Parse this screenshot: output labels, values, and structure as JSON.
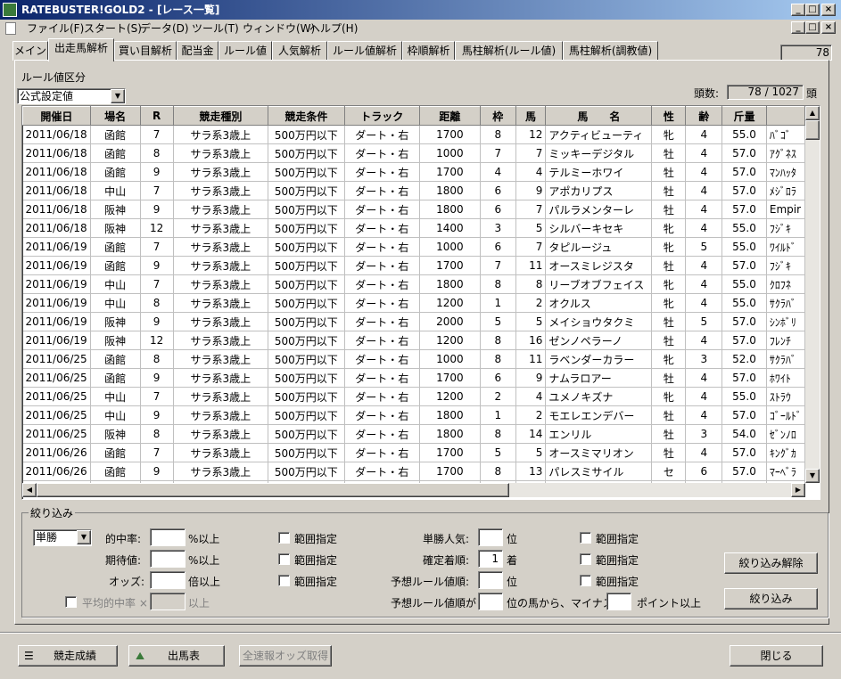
{
  "window": {
    "title": "RATEBUSTER!GOLD2 - [レース一覧]",
    "min": "_",
    "max": "□",
    "close": "×"
  },
  "menu": [
    "ファイル(F)",
    "スタート(S)",
    "データ(D)",
    "ツール(T)",
    "ウィンドウ(W)",
    "ヘルプ(H)"
  ],
  "tabs": [
    "メイン",
    "出走馬解析",
    "買い目解析",
    "配当金",
    "ルール値",
    "人気解析",
    "ルール値解析",
    "枠順解析",
    "馬柱解析(ルール値)",
    "馬柱解析(調教値)"
  ],
  "active_tab": "出走馬解析",
  "top_counter": "78",
  "rule_section": {
    "label": "ルール値区分",
    "selected": "公式設定値"
  },
  "count": {
    "label": "頭数:",
    "value": "78 / 1027",
    "unit": "頭"
  },
  "table": {
    "columns": [
      "開催日",
      "場名",
      "R",
      "競走種別",
      "競走条件",
      "トラック",
      "距離",
      "枠",
      "馬",
      "馬　　名",
      "性",
      "齢",
      "斤量",
      ""
    ],
    "rows": [
      [
        "2011/06/18",
        "函館",
        "7",
        "サラ系3歳上",
        "500万円以下",
        "ダート・右",
        "1700",
        "8",
        "12",
        "アクティビューティ",
        "牝",
        "4",
        "55.0",
        "ﾊﾞｺﾞ"
      ],
      [
        "2011/06/18",
        "函館",
        "8",
        "サラ系3歳上",
        "500万円以下",
        "ダート・右",
        "1000",
        "7",
        "7",
        "ミッキーデジタル",
        "牡",
        "4",
        "57.0",
        "ｱｸﾞﾈｽ"
      ],
      [
        "2011/06/18",
        "函館",
        "9",
        "サラ系3歳上",
        "500万円以下",
        "ダート・右",
        "1700",
        "4",
        "4",
        "テルミーホワイ",
        "牡",
        "4",
        "57.0",
        "ﾏﾝﾊｯﾀ"
      ],
      [
        "2011/06/18",
        "中山",
        "7",
        "サラ系3歳上",
        "500万円以下",
        "ダート・右",
        "1800",
        "6",
        "9",
        "アポカリプス",
        "牡",
        "4",
        "57.0",
        "ﾒｼﾞﾛﾗ"
      ],
      [
        "2011/06/18",
        "阪神",
        "9",
        "サラ系3歳上",
        "500万円以下",
        "ダート・右",
        "1800",
        "6",
        "7",
        "パルラメンターレ",
        "牡",
        "4",
        "57.0",
        "Empir"
      ],
      [
        "2011/06/18",
        "阪神",
        "12",
        "サラ系3歳上",
        "500万円以下",
        "ダート・右",
        "1400",
        "3",
        "5",
        "シルバーキセキ",
        "牝",
        "4",
        "55.0",
        "ﾌｼﾞｷ"
      ],
      [
        "2011/06/19",
        "函館",
        "7",
        "サラ系3歳上",
        "500万円以下",
        "ダート・右",
        "1000",
        "6",
        "7",
        "タピルージュ",
        "牝",
        "5",
        "55.0",
        "ﾜｲﾙﾄﾞ"
      ],
      [
        "2011/06/19",
        "函館",
        "9",
        "サラ系3歳上",
        "500万円以下",
        "ダート・右",
        "1700",
        "7",
        "11",
        "オースミレジスタ",
        "牡",
        "4",
        "57.0",
        "ﾌｼﾞｷ"
      ],
      [
        "2011/06/19",
        "中山",
        "7",
        "サラ系3歳上",
        "500万円以下",
        "ダート・右",
        "1800",
        "8",
        "8",
        "リーブオブフェイス",
        "牝",
        "4",
        "55.0",
        "ｸﾛﾌﾈ"
      ],
      [
        "2011/06/19",
        "中山",
        "8",
        "サラ系3歳上",
        "500万円以下",
        "ダート・右",
        "1200",
        "1",
        "2",
        "オクルス",
        "牝",
        "4",
        "55.0",
        "ｻｸﾗﾊﾞ"
      ],
      [
        "2011/06/19",
        "阪神",
        "9",
        "サラ系3歳上",
        "500万円以下",
        "ダート・右",
        "2000",
        "5",
        "5",
        "メイショウタクミ",
        "牡",
        "5",
        "57.0",
        "ｼﾝﾎﾞﾘ"
      ],
      [
        "2011/06/19",
        "阪神",
        "12",
        "サラ系3歳上",
        "500万円以下",
        "ダート・右",
        "1200",
        "8",
        "16",
        "ゼンノペラーノ",
        "牡",
        "4",
        "57.0",
        "ﾌﾚﾝﾁ"
      ],
      [
        "2011/06/25",
        "函館",
        "8",
        "サラ系3歳上",
        "500万円以下",
        "ダート・右",
        "1000",
        "8",
        "11",
        "ラベンダーカラー",
        "牝",
        "3",
        "52.0",
        "ｻｸﾗﾊﾞ"
      ],
      [
        "2011/06/25",
        "函館",
        "9",
        "サラ系3歳上",
        "500万円以下",
        "ダート・右",
        "1700",
        "6",
        "9",
        "ナムラロアー",
        "牡",
        "4",
        "57.0",
        "ﾎﾜｲﾄ"
      ],
      [
        "2011/06/25",
        "中山",
        "7",
        "サラ系3歳上",
        "500万円以下",
        "ダート・右",
        "1200",
        "2",
        "4",
        "ユメノキズナ",
        "牝",
        "4",
        "55.0",
        "ｽﾄﾗｳ"
      ],
      [
        "2011/06/25",
        "中山",
        "9",
        "サラ系3歳上",
        "500万円以下",
        "ダート・右",
        "1800",
        "1",
        "2",
        "モエレエンデバー",
        "牡",
        "4",
        "57.0",
        "ｺﾞｰﾙﾄﾞ"
      ],
      [
        "2011/06/25",
        "阪神",
        "8",
        "サラ系3歳上",
        "500万円以下",
        "ダート・右",
        "1800",
        "8",
        "14",
        "エンリル",
        "牡",
        "3",
        "54.0",
        "ｾﾞﾝﾉﾛ"
      ],
      [
        "2011/06/26",
        "函館",
        "7",
        "サラ系3歳上",
        "500万円以下",
        "ダート・右",
        "1700",
        "5",
        "5",
        "オースミマリオン",
        "牡",
        "4",
        "57.0",
        "ｷﾝｸﾞｶ"
      ],
      [
        "2011/06/26",
        "函館",
        "9",
        "サラ系3歳上",
        "500万円以下",
        "ダート・右",
        "1700",
        "8",
        "13",
        "パレスミサイル",
        "セ",
        "6",
        "57.0",
        "ﾏｰﾍﾞﾗ"
      ],
      [
        "2011/06/26",
        "中山",
        "9",
        "サラ系3歳上",
        "500万円以下",
        "ダート・右",
        "1800",
        "8",
        "9",
        "アサギタイム",
        "牝",
        "4",
        "55.0",
        "ﾄﾞﾊﾞ"
      ]
    ]
  },
  "filter": {
    "title": "絞り込み",
    "bet_type": "単勝",
    "hit_rate_label": "的中率:",
    "expected_label": "期待値:",
    "odds_label": "オッズ:",
    "pct_over": "%以上",
    "times_over": "倍以上",
    "range_label": "範囲指定",
    "avg_hit_label": "平均的中率 ×",
    "avg_over": "以上",
    "pop_label": "単勝人気:",
    "finish_label": "確定着順:",
    "rank_label": "予想ルール値順:",
    "rank_unit": "位",
    "finish_unit": "着",
    "finish_value": "1",
    "rule_rank_from": "予想ルール値順が",
    "rule_rank_mid": "位の馬から、マイナス",
    "rule_rank_end": "ポイント以上",
    "clear_button": "絞り込み解除",
    "apply_button": "絞り込み"
  },
  "bottom": {
    "results_button": "競走成績",
    "entries_button": "出馬表",
    "odds_button": "全速報オッズ取得",
    "close_button": "閉じる"
  }
}
